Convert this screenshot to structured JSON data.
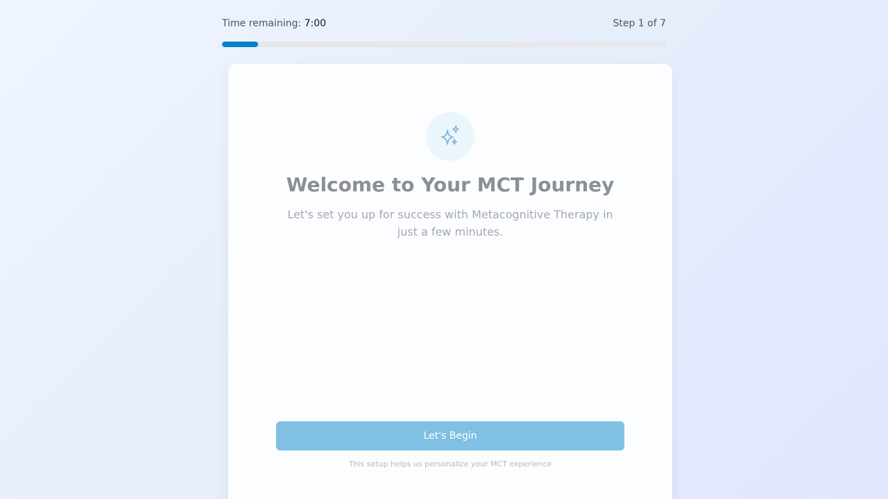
{
  "header": {
    "time_label": "Time remaining:",
    "time_value": "7:00",
    "step_text": "Step 1 of 7"
  },
  "progress": {
    "fraction": 0.0814,
    "color": "#0284c7"
  },
  "welcome": {
    "icon": "sparkles-icon",
    "title": "Welcome to Your MCT Journey",
    "subtitle": "Let's set you up for success with Metacognitive Therapy in just a few minutes.",
    "begin_label": "Let's Begin",
    "footnote": "This setup helps us personalize your MCT experience"
  },
  "colors": {
    "accent": "#0284c7",
    "button": "#7fc0e3",
    "icon": "#7fb6da"
  }
}
